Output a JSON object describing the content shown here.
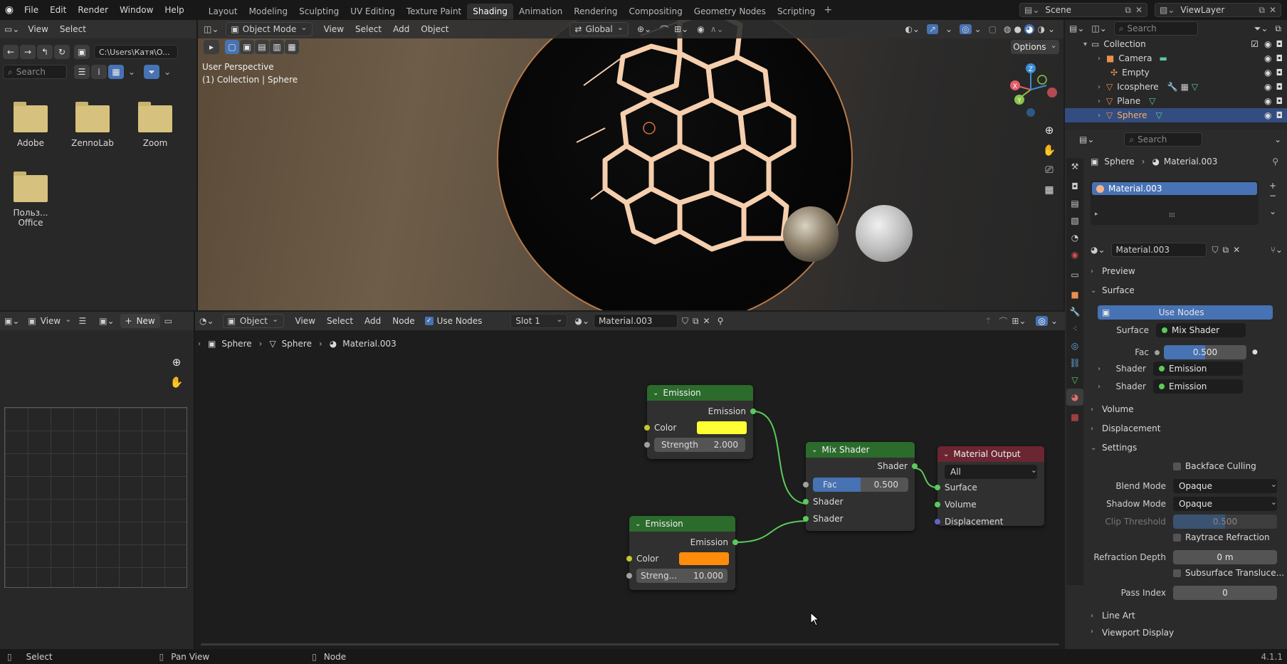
{
  "topbar": {
    "menus": [
      "File",
      "Edit",
      "Render",
      "Window",
      "Help"
    ],
    "workspaces": [
      "Layout",
      "Modeling",
      "Sculpting",
      "UV Editing",
      "Texture Paint",
      "Shading",
      "Animation",
      "Rendering",
      "Compositing",
      "Geometry Nodes",
      "Scripting"
    ],
    "active_workspace": "Shading",
    "scene": "Scene",
    "view_layer": "ViewLayer"
  },
  "filebrowser": {
    "menus": [
      "View",
      "Select"
    ],
    "path": "C:\\Users\\Катя\\O...",
    "search_placeholder": "Search",
    "folders": [
      "Adobe",
      "ZennoLab",
      "Zoom",
      "Польз... Office"
    ]
  },
  "viewport": {
    "mode": "Object Mode",
    "menus": [
      "View",
      "Select",
      "Add",
      "Object"
    ],
    "orientation": "Global",
    "options_label": "Options",
    "overlay_line1": "User Perspective",
    "overlay_line2": "(1) Collection | Sphere",
    "axis_x": "X",
    "axis_y": "Y",
    "axis_z": "Z"
  },
  "outliner": {
    "search_placeholder": "Search",
    "items": [
      {
        "label": "Collection",
        "selected": false
      },
      {
        "label": "Camera",
        "selected": false
      },
      {
        "label": "Empty",
        "selected": false
      },
      {
        "label": "Icosphere",
        "selected": false
      },
      {
        "label": "Plane",
        "selected": false
      },
      {
        "label": "Sphere",
        "selected": true
      }
    ]
  },
  "properties": {
    "search_placeholder": "Search",
    "breadcrumb_object": "Sphere",
    "breadcrumb_material": "Material.003",
    "slot_material": "Material.003",
    "material_name": "Material.003",
    "panels": {
      "preview": "Preview",
      "surface": "Surface",
      "volume": "Volume",
      "displacement": "Displacement",
      "settings": "Settings",
      "line_art": "Line Art",
      "viewport_display": "Viewport Display"
    },
    "use_nodes": "Use Nodes",
    "surface_label": "Surface",
    "surface_value": "Mix Shader",
    "fac_label": "Fac",
    "fac_value": "0.500",
    "shader1_label": "Shader",
    "shader1_value": "Emission",
    "shader2_label": "Shader",
    "shader2_value": "Emission",
    "backface": "Backface Culling",
    "blend_label": "Blend Mode",
    "blend_value": "Opaque",
    "shadow_label": "Shadow Mode",
    "shadow_value": "Opaque",
    "clip_label": "Clip Threshold",
    "clip_value": "0.500",
    "raytrace": "Raytrace Refraction",
    "refr_label": "Refraction Depth",
    "refr_value": "0 m",
    "sss": "Subsurface Transluce...",
    "pass_label": "Pass Index",
    "pass_value": "0"
  },
  "imgeditor": {
    "view": "View",
    "new": "New"
  },
  "nodeeditor": {
    "object_mode": "Object",
    "menus": [
      "View",
      "Select",
      "Add",
      "Node"
    ],
    "use_nodes": "Use Nodes",
    "slot": "Slot 1",
    "material": "Material.003",
    "breadcrumb": [
      "Sphere",
      "Sphere",
      "Material.003"
    ],
    "emission1": {
      "title": "Emission",
      "out": "Emission",
      "color_label": "Color",
      "color": "#ffff33",
      "strength_label": "Strength",
      "strength": "2.000"
    },
    "emission2": {
      "title": "Emission",
      "out": "Emission",
      "color_label": "Color",
      "color": "#ff8c0a",
      "strength_label": "Streng...",
      "strength": "10.000"
    },
    "mix": {
      "title": "Mix Shader",
      "out": "Shader",
      "fac_label": "Fac",
      "fac": "0.500",
      "fac_fraction": 0.5,
      "in1": "Shader",
      "in2": "Shader"
    },
    "output": {
      "title": "Material Output",
      "target": "All",
      "in1": "Surface",
      "in2": "Volume",
      "in3": "Displacement"
    }
  },
  "statusbar": {
    "select": "Select",
    "pan": "Pan View",
    "node": "Node",
    "version": "4.1.1"
  }
}
